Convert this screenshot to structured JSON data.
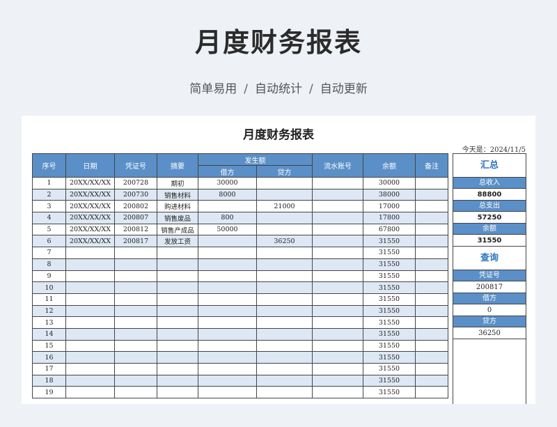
{
  "banner": {
    "title": "月度财务报表",
    "subtitle_parts": [
      "简单易用",
      "自动统计",
      "自动更新"
    ],
    "separator": "/"
  },
  "sheet": {
    "title": "月度财务报表",
    "today_label": "今天是：2024/11/5",
    "headers": {
      "seq": "序号",
      "date": "日期",
      "voucher": "凭证号",
      "summary": "摘要",
      "amount_group": "发生额",
      "debit": "借方",
      "credit": "贷方",
      "serial": "流水账号",
      "balance": "余额",
      "note": "备注"
    },
    "rows": [
      {
        "seq": "1",
        "date": "20XX/XX/XX",
        "voucher": "200728",
        "summary": "期初",
        "debit": "30000",
        "credit": "",
        "serial": "",
        "balance": "30000",
        "note": ""
      },
      {
        "seq": "2",
        "date": "20XX/XX/XX",
        "voucher": "200730",
        "summary": "销售材料",
        "debit": "8000",
        "credit": "",
        "serial": "",
        "balance": "38000",
        "note": ""
      },
      {
        "seq": "3",
        "date": "20XX/XX/XX",
        "voucher": "200802",
        "summary": "购进材料",
        "debit": "",
        "credit": "21000",
        "serial": "",
        "balance": "17000",
        "note": ""
      },
      {
        "seq": "4",
        "date": "20XX/XX/XX",
        "voucher": "200807",
        "summary": "销售废品",
        "debit": "800",
        "credit": "",
        "serial": "",
        "balance": "17800",
        "note": ""
      },
      {
        "seq": "5",
        "date": "20XX/XX/XX",
        "voucher": "200812",
        "summary": "销售产成品",
        "debit": "50000",
        "credit": "",
        "serial": "",
        "balance": "67800",
        "note": ""
      },
      {
        "seq": "6",
        "date": "20XX/XX/XX",
        "voucher": "200817",
        "summary": "发放工资",
        "debit": "",
        "credit": "36250",
        "serial": "",
        "balance": "31550",
        "note": ""
      },
      {
        "seq": "7",
        "date": "",
        "voucher": "",
        "summary": "",
        "debit": "",
        "credit": "",
        "serial": "",
        "balance": "31550",
        "note": ""
      },
      {
        "seq": "8",
        "date": "",
        "voucher": "",
        "summary": "",
        "debit": "",
        "credit": "",
        "serial": "",
        "balance": "31550",
        "note": ""
      },
      {
        "seq": "9",
        "date": "",
        "voucher": "",
        "summary": "",
        "debit": "",
        "credit": "",
        "serial": "",
        "balance": "31550",
        "note": ""
      },
      {
        "seq": "10",
        "date": "",
        "voucher": "",
        "summary": "",
        "debit": "",
        "credit": "",
        "serial": "",
        "balance": "31550",
        "note": ""
      },
      {
        "seq": "11",
        "date": "",
        "voucher": "",
        "summary": "",
        "debit": "",
        "credit": "",
        "serial": "",
        "balance": "31550",
        "note": ""
      },
      {
        "seq": "12",
        "date": "",
        "voucher": "",
        "summary": "",
        "debit": "",
        "credit": "",
        "serial": "",
        "balance": "31550",
        "note": ""
      },
      {
        "seq": "13",
        "date": "",
        "voucher": "",
        "summary": "",
        "debit": "",
        "credit": "",
        "serial": "",
        "balance": "31550",
        "note": ""
      },
      {
        "seq": "14",
        "date": "",
        "voucher": "",
        "summary": "",
        "debit": "",
        "credit": "",
        "serial": "",
        "balance": "31550",
        "note": ""
      },
      {
        "seq": "15",
        "date": "",
        "voucher": "",
        "summary": "",
        "debit": "",
        "credit": "",
        "serial": "",
        "balance": "31550",
        "note": ""
      },
      {
        "seq": "16",
        "date": "",
        "voucher": "",
        "summary": "",
        "debit": "",
        "credit": "",
        "serial": "",
        "balance": "31550",
        "note": ""
      },
      {
        "seq": "17",
        "date": "",
        "voucher": "",
        "summary": "",
        "debit": "",
        "credit": "",
        "serial": "",
        "balance": "31550",
        "note": ""
      },
      {
        "seq": "18",
        "date": "",
        "voucher": "",
        "summary": "",
        "debit": "",
        "credit": "",
        "serial": "",
        "balance": "31550",
        "note": ""
      },
      {
        "seq": "19",
        "date": "",
        "voucher": "",
        "summary": "",
        "debit": "",
        "credit": "",
        "serial": "",
        "balance": "31550",
        "note": ""
      }
    ]
  },
  "summary_panel": {
    "title": "汇总",
    "income_label": "总收入",
    "income_value": "88800",
    "expense_label": "总支出",
    "expense_value": "57250",
    "balance_label": "余额",
    "balance_value": "31550"
  },
  "query_panel": {
    "title": "查询",
    "voucher_label": "凭证号",
    "voucher_value": "200817",
    "debit_label": "借方",
    "debit_value": "0",
    "credit_label": "贷方",
    "credit_value": "36250"
  },
  "colors": {
    "header_blue": "#5b8fc7",
    "row_alt": "#dde8f4",
    "accent_text": "#2f75c0"
  }
}
